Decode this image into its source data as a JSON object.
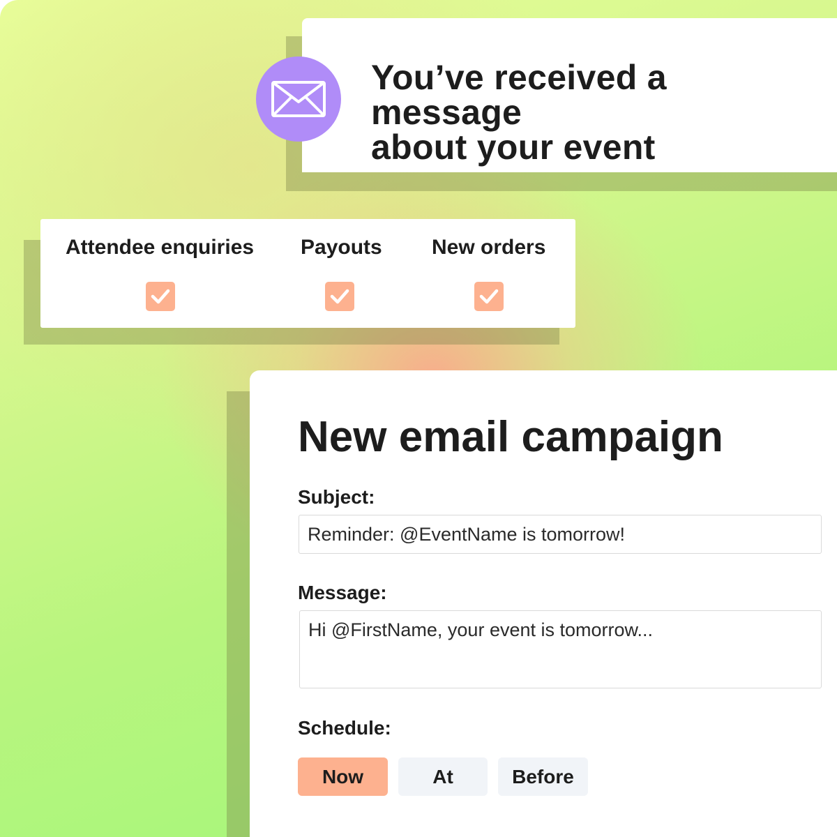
{
  "notification": {
    "icon": "envelope-icon",
    "line1": "You’ve received a message",
    "line2": "about your event",
    "icon_color": "#b08cf8"
  },
  "toggles": {
    "items": [
      {
        "label": "Attendee enquiries",
        "checked": true
      },
      {
        "label": "Payouts",
        "checked": true
      },
      {
        "label": "New orders",
        "checked": true
      }
    ],
    "check_color": "#fdb18f"
  },
  "campaign": {
    "title": "New email campaign",
    "subject_label": "Subject:",
    "subject_value": "Reminder: @EventName is tomorrow!",
    "message_label": "Message:",
    "message_value": "Hi @FirstName, your event is tomorrow...",
    "schedule_label": "Schedule:",
    "schedule_options": [
      {
        "label": "Now",
        "selected": true
      },
      {
        "label": "At",
        "selected": false
      },
      {
        "label": "Before",
        "selected": false
      }
    ],
    "selected_color": "#fdb18f",
    "unselected_color": "#f1f4f8"
  }
}
